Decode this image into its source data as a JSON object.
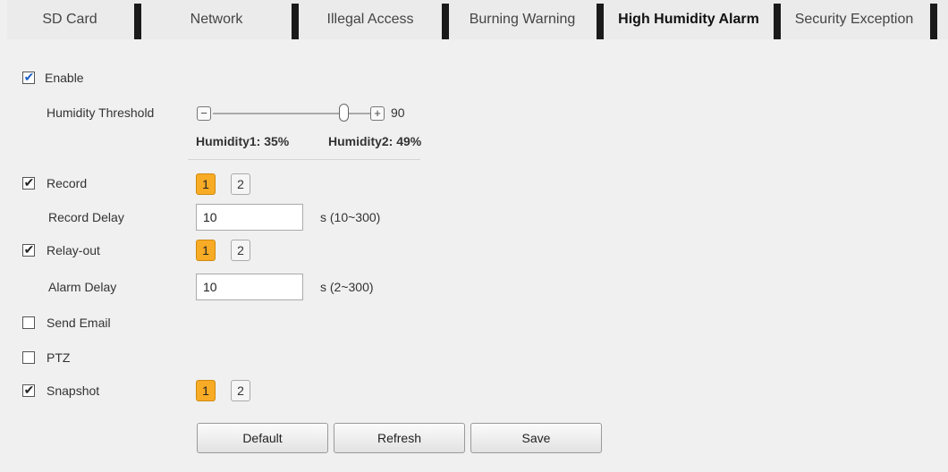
{
  "tabs": [
    {
      "label": "SD Card",
      "active": false
    },
    {
      "label": "Network",
      "active": false
    },
    {
      "label": "Illegal Access",
      "active": false
    },
    {
      "label": "Burning Warning",
      "active": false
    },
    {
      "label": "High Humidity Alarm",
      "active": true
    },
    {
      "label": "Security Exception",
      "active": false
    }
  ],
  "form": {
    "enable": {
      "label": "Enable",
      "checked": true
    },
    "humidity_threshold": {
      "label": "Humidity Threshold",
      "minus_icon": "minus-icon",
      "plus_icon": "plus-icon",
      "value": "90",
      "level_fraction": 0.9,
      "humidity1": "Humidity1: 35%",
      "humidity2": "Humidity2: 49%"
    },
    "record": {
      "label": "Record",
      "checked": true,
      "channels": [
        {
          "label": "1",
          "selected": true
        },
        {
          "label": "2",
          "selected": false
        }
      ]
    },
    "record_delay": {
      "label": "Record Delay",
      "value": "10",
      "unit": "s (10~300)"
    },
    "relay_out": {
      "label": "Relay-out",
      "checked": true,
      "channels": [
        {
          "label": "1",
          "selected": true
        },
        {
          "label": "2",
          "selected": false
        }
      ]
    },
    "alarm_delay": {
      "label": "Alarm Delay",
      "value": "10",
      "unit": "s (2~300)"
    },
    "send_email": {
      "label": "Send Email",
      "checked": false
    },
    "ptz": {
      "label": "PTZ",
      "checked": false
    },
    "snapshot": {
      "label": "Snapshot",
      "checked": true,
      "channels": [
        {
          "label": "1",
          "selected": true
        },
        {
          "label": "2",
          "selected": false
        }
      ]
    }
  },
  "buttons": {
    "default": "Default",
    "refresh": "Refresh",
    "save": "Save"
  },
  "colors": {
    "channel_selected": "#f8ab25",
    "enable_check": "#1a5fc4",
    "page_bg": "#f0f0f0"
  }
}
